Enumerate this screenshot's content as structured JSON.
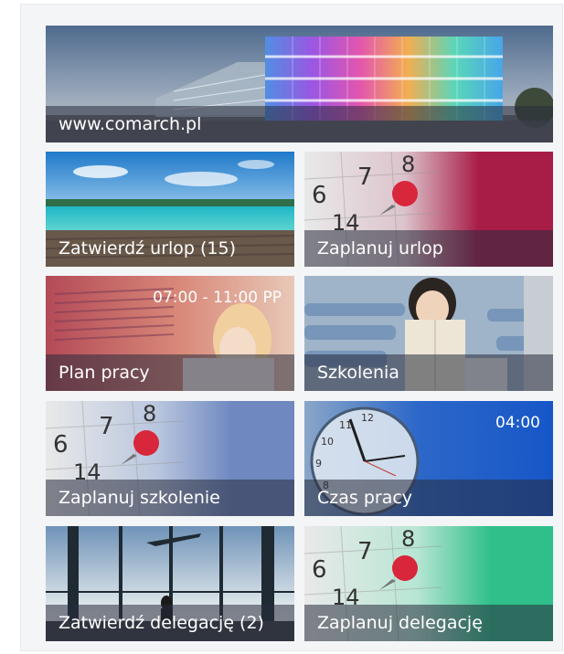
{
  "hero": {
    "label": "www.comarch.pl",
    "image": "comarch-building-photo"
  },
  "tiles": [
    {
      "id": "approve-leave",
      "label": "Zatwierdź urlop (15)",
      "image": "beach-photo"
    },
    {
      "id": "plan-leave",
      "label": "Zaplanuj urlop",
      "image": "calendar-pin-photo",
      "accent": "#a81d48"
    },
    {
      "id": "work-plan",
      "label": "Plan pracy",
      "value": "07:00 - 11:00 PP",
      "image": "woman-with-chart-photo"
    },
    {
      "id": "trainings",
      "label": "Szkolenia",
      "image": "student-with-book-photo"
    },
    {
      "id": "plan-training",
      "label": "Zaplanuj szkolenie",
      "image": "calendar-pin-photo",
      "accent": "#6f88c0"
    },
    {
      "id": "work-time",
      "label": "Czas pracy",
      "value": "04:00",
      "image": "clock-photo",
      "accent": "#1656c8"
    },
    {
      "id": "approve-delegation",
      "label": "Zatwierdź delegację (2)",
      "image": "airport-photo"
    },
    {
      "id": "plan-delegation",
      "label": "Zaplanuj delegację",
      "image": "calendar-pin-photo",
      "accent": "#2fbf8a"
    }
  ]
}
